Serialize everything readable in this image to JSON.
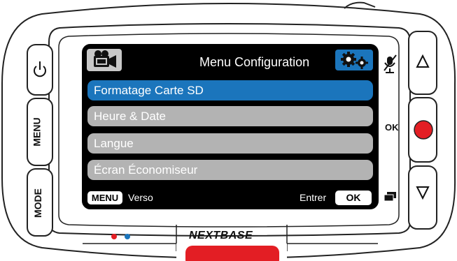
{
  "screen": {
    "title": "Menu Configuration",
    "items": [
      {
        "label": "Formatage Carte SD",
        "selected": true
      },
      {
        "label": "Heure & Date",
        "selected": false
      },
      {
        "label": "Langue",
        "selected": false
      },
      {
        "label": "Écran Économiseur",
        "selected": false
      }
    ],
    "footer": {
      "back_key": "MENU",
      "back_label": "Verso",
      "enter_label": "Entrer",
      "enter_key": "OK"
    }
  },
  "device": {
    "left_buttons": {
      "menu": "MENU",
      "mode": "MODE"
    },
    "right_ok_label": "OK",
    "brand": "NEXTBASE"
  },
  "colors": {
    "selection": "#1b75bc",
    "item_bg": "#b3b3b3",
    "record_button": "#e31e24",
    "led_red": "#e31e24",
    "led_blue": "#1b75bc"
  },
  "icons": [
    "power-icon",
    "video-camera-icon",
    "settings-gears-icon",
    "mute-microphone-icon",
    "up-arrow-icon",
    "record-icon",
    "display-toggle-icon",
    "down-arrow-icon"
  ]
}
